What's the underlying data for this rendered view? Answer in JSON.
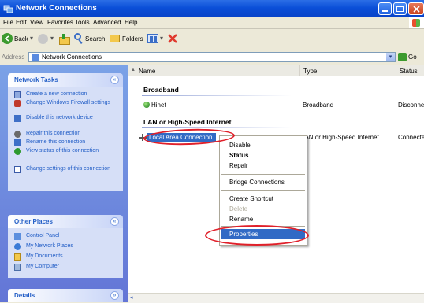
{
  "window": {
    "title": "Network Connections"
  },
  "menubar": [
    "File",
    "Edit",
    "View",
    "Favorites",
    "Tools",
    "Advanced",
    "Help"
  ],
  "toolbar": {
    "back": "Back",
    "search": "Search",
    "folders": "Folders"
  },
  "address": {
    "label": "Address",
    "value": "Network Connections",
    "go": "Go"
  },
  "taskpane": {
    "network_tasks": {
      "title": "Network Tasks",
      "items": [
        "Create a new connection",
        "Change Windows Firewall settings",
        "Disable this network device",
        "Repair this connection",
        "Rename this connection",
        "View status of this connection",
        "Change settings of this connection"
      ]
    },
    "other_places": {
      "title": "Other Places",
      "items": [
        "Control Panel",
        "My Network Places",
        "My Documents",
        "My Computer"
      ]
    },
    "details": {
      "title": "Details"
    }
  },
  "columns": {
    "name": "Name",
    "type": "Type",
    "status": "Status"
  },
  "groups": {
    "broadband": "Broadband",
    "lan": "LAN or High-Speed Internet"
  },
  "connections": {
    "hinet": {
      "name": "Hinet",
      "type": "Broadband",
      "status": "Disconne"
    },
    "local": {
      "name": "Local Area Connection",
      "type": "LAN or High-Speed Internet",
      "status": "Connecte"
    }
  },
  "context_menu": {
    "disable": "Disable",
    "status": "Status",
    "repair": "Repair",
    "bridge": "Bridge Connections",
    "shortcut": "Create Shortcut",
    "delete": "Delete",
    "rename": "Rename",
    "properties": "Properties"
  },
  "colors": {
    "titlebar": "#0A4FD8",
    "taskpane": "#6375D6",
    "highlight": "#316AC5",
    "annotation": "#E0202A"
  }
}
